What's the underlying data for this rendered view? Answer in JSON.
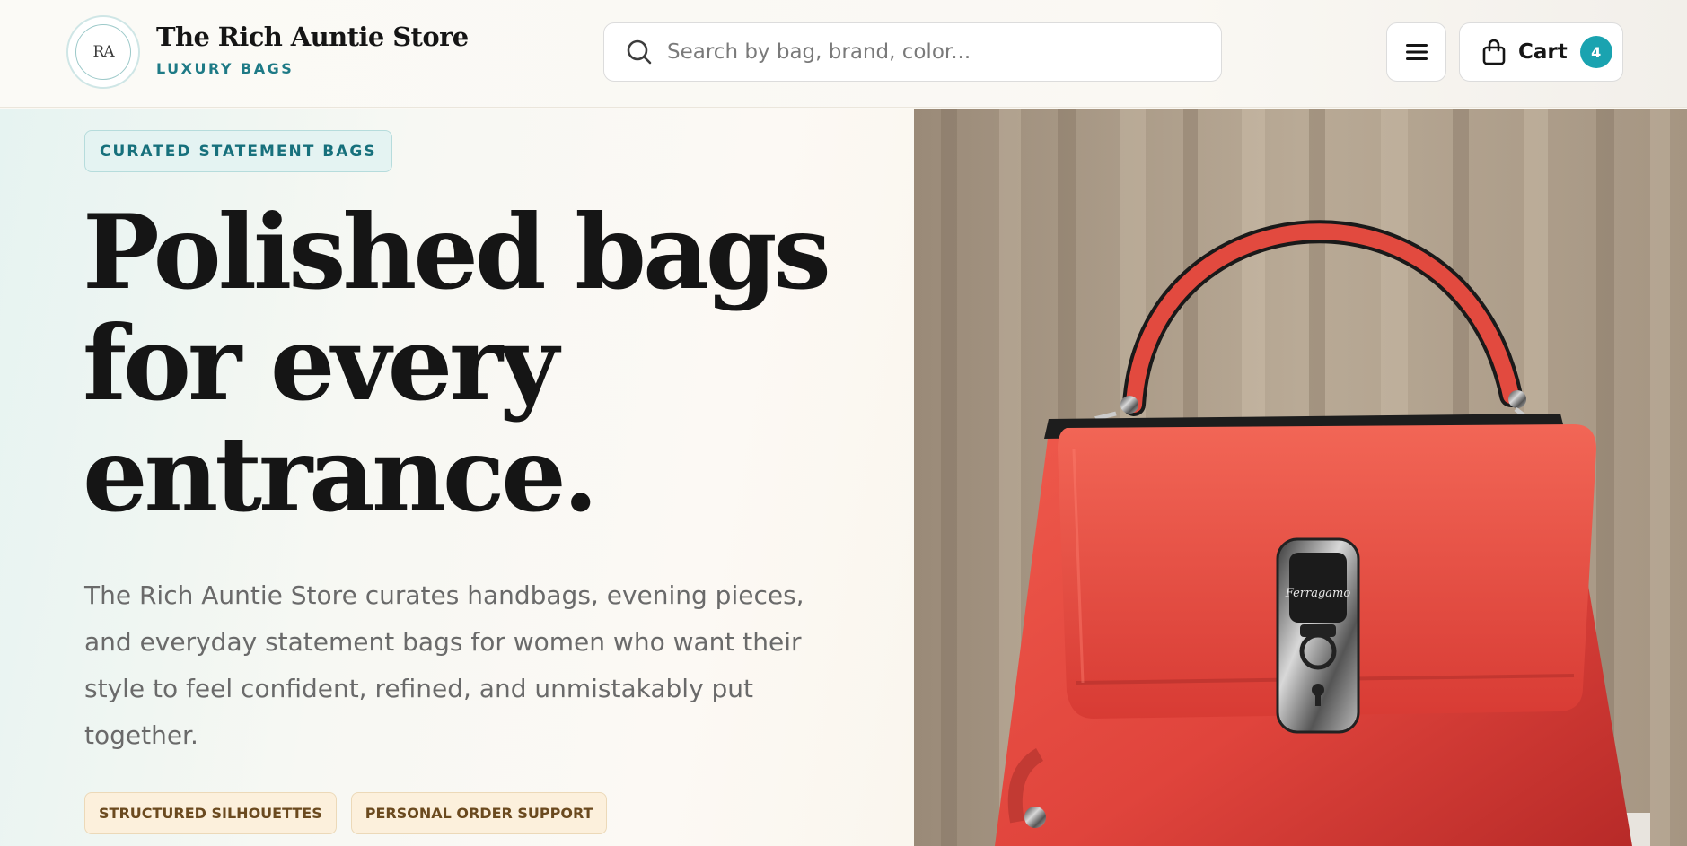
{
  "header": {
    "logo_monogram": "RA",
    "brand_name": "The Rich Auntie Store",
    "brand_tagline": "LUXURY BAGS",
    "search": {
      "placeholder": "Search by bag, brand, color...",
      "value": ""
    },
    "menu_icon": "hamburger-icon",
    "cart": {
      "label": "Cart",
      "count": "4",
      "icon": "shopping-bag-icon"
    }
  },
  "hero": {
    "eyebrow": "CURATED STATEMENT BAGS",
    "headline_lines": [
      "Polished bags",
      "for every",
      "entrance."
    ],
    "description": "The Rich Auntie Store curates handbags, evening pieces, and everyday statement bags for women who want their style to feel confident, refined, and unmistakably put together.",
    "chips": [
      "STRUCTURED SILHOUETTES",
      "PERSONAL ORDER SUPPORT"
    ],
    "image_label": "Ferragamo"
  },
  "colors": {
    "accent_teal": "#1aa3b0",
    "brand_teal_text": "#1e7a86",
    "bag_red": "#e0443c",
    "chip_bg": "#fcf0dc"
  }
}
